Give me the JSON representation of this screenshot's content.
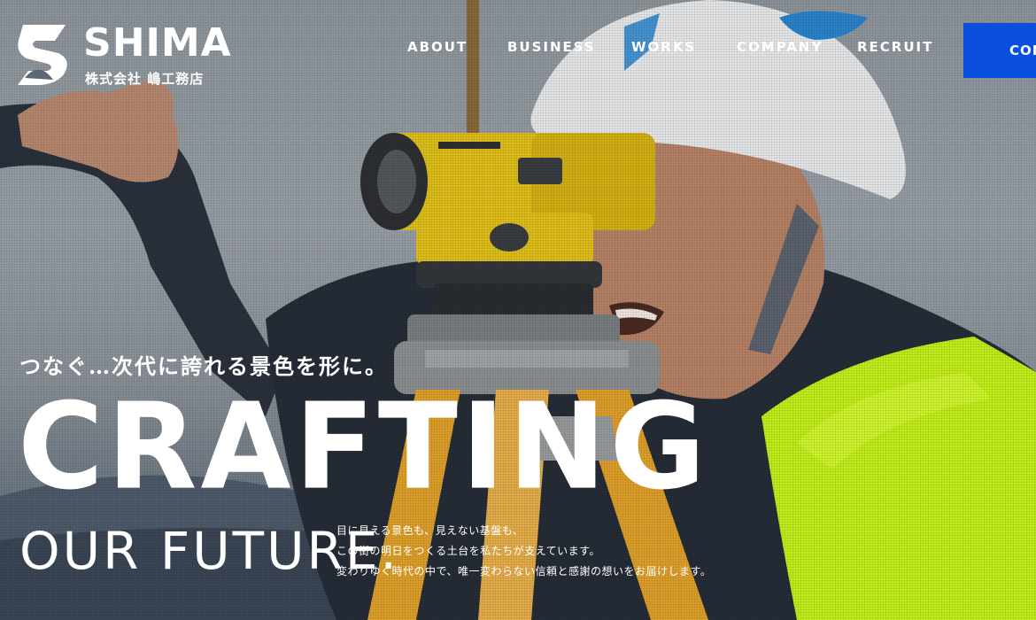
{
  "brand": {
    "name": "SHIMA",
    "subtitle": "株式会社 嶋工務店"
  },
  "nav": {
    "items": [
      {
        "label": "ABOUT"
      },
      {
        "label": "BUSINESS"
      },
      {
        "label": "WORKS"
      },
      {
        "label": "COMPANY"
      },
      {
        "label": "RECRUIT"
      }
    ],
    "contact_label": "CONTACT"
  },
  "hero": {
    "tagline": "つなぐ…次代に誇れる景色を形に。",
    "headline": "CRAFTING",
    "subheadline": "OUR FUTURE.",
    "body": [
      "目に見える景色も、見えない基盤も、",
      "この街の明日をつくる土台を私たちが支えています。",
      "変わりゆく時代の中で、唯一変わらない信頼と感謝の想いをお届けします。"
    ],
    "image_subject": "surveyor-with-auto-level"
  },
  "colors": {
    "accent": "#0a4fe0",
    "text": "#ffffff",
    "vest": "#c6f21a",
    "level": "#e3c21b",
    "helmet": "#e9ecee"
  }
}
